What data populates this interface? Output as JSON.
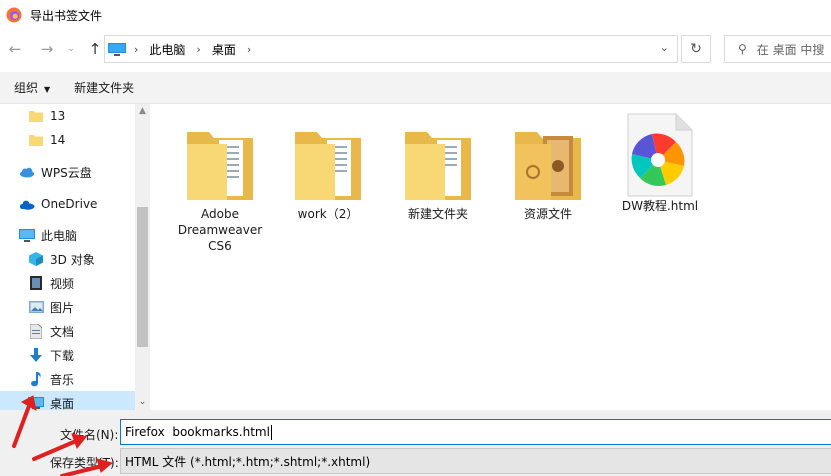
{
  "window": {
    "title": "导出书签文件"
  },
  "nav": {
    "back_icon": "back-arrow-icon",
    "forward_icon": "forward-arrow-icon",
    "recent_icon": "chevron-down-icon",
    "up_icon": "up-arrow-icon"
  },
  "address": {
    "crumbs": [
      "此电脑",
      "桌面"
    ]
  },
  "search": {
    "placeholder": "在 桌面 中搜"
  },
  "toolbar": {
    "organize_label": "组织",
    "new_folder_label": "新建文件夹"
  },
  "sidebar": {
    "items": [
      {
        "label": "13",
        "icon": "folder-icon"
      },
      {
        "label": "14",
        "icon": "folder-icon"
      },
      {
        "label": "WPS云盘",
        "icon": "cloud-icon"
      },
      {
        "label": "OneDrive",
        "icon": "onedrive-icon"
      },
      {
        "label": "此电脑",
        "icon": "computer-icon"
      },
      {
        "label": "3D 对象",
        "icon": "cube-icon"
      },
      {
        "label": "视频",
        "icon": "video-icon"
      },
      {
        "label": "图片",
        "icon": "picture-icon"
      },
      {
        "label": "文档",
        "icon": "document-icon"
      },
      {
        "label": "下载",
        "icon": "download-icon"
      },
      {
        "label": "音乐",
        "icon": "music-icon"
      },
      {
        "label": "桌面",
        "icon": "desktop-icon",
        "selected": true
      }
    ]
  },
  "files": [
    {
      "name": "Adobe Dreamweaver CS6",
      "icon": "folder-icon"
    },
    {
      "name": "work（2）",
      "icon": "folder-icon"
    },
    {
      "name": "新建文件夹",
      "icon": "folder-icon"
    },
    {
      "name": "资源文件",
      "icon": "folder-icon"
    },
    {
      "name": "DW教程.html",
      "icon": "html-file-icon"
    }
  ],
  "save": {
    "filename_label": "文件名(N):",
    "filename_value": "Firefox  bookmarks.html",
    "filetype_label": "保存类型(T):",
    "filetype_value": "HTML 文件 (*.html;*.htm;*.shtml;*.xhtml)"
  },
  "colors": {
    "selected_bg": "#cce8ff",
    "accent": "#0078d7",
    "folder": "#f8d775",
    "annotation_arrow": "#e02020"
  }
}
